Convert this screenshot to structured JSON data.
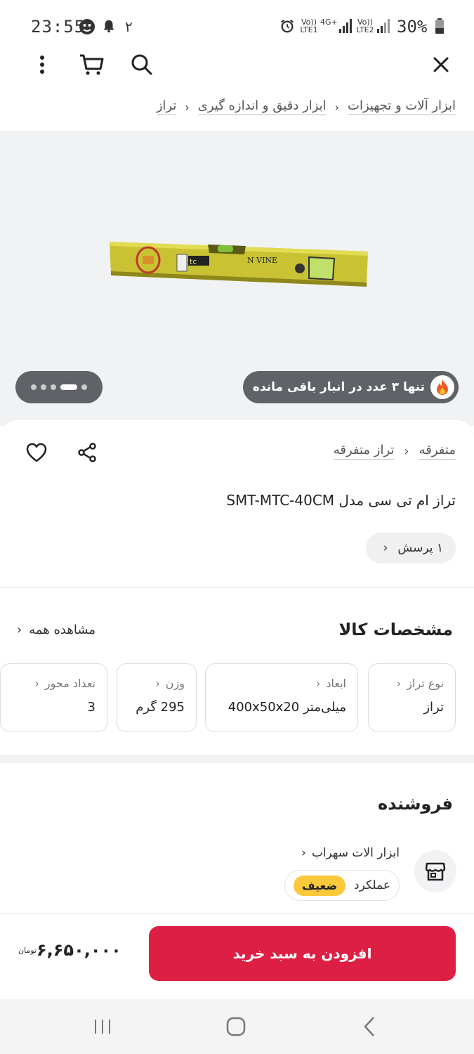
{
  "status_bar": {
    "time": "23:55",
    "notif_count": "۲",
    "net1_top": "Vo))",
    "net1_bottom": "LTE1",
    "net_type": "4G+",
    "net2_top": "Vo))",
    "net2_bottom": "LTE2",
    "battery": "30%"
  },
  "breadcrumb": {
    "items": [
      "ابزار آلات و تجهیزات",
      "ابزار دقیق و  اندازه گیری",
      "تراز"
    ]
  },
  "gallery": {
    "stock_text": "تنها ۳ عدد در انبار باقی مانده",
    "image_label": "N VINE",
    "image_sub": "tc",
    "dots_total": 5,
    "dots_active_index": 3
  },
  "product": {
    "category": "متفرقه",
    "subcategory": "تراز متفرقه",
    "title": "تراز ام تی سی مدل SMT-MTC-40CM",
    "questions": "۱ پرسش"
  },
  "specs": {
    "heading": "مشخصات کالا",
    "see_all": "مشاهده همه",
    "items": [
      {
        "label": "نوع تراز",
        "value": "تراز"
      },
      {
        "label": "ابعاد",
        "value": "میلی‌متر 400x50x20"
      },
      {
        "label": "وزن",
        "value": "295 گرم"
      },
      {
        "label": "تعداد محور",
        "value": "3"
      }
    ]
  },
  "seller": {
    "heading": "فروشنده",
    "name": "ابزار الات سهراب",
    "performance_label": "عملکرد",
    "performance_value": "ضعیف"
  },
  "buy": {
    "button_label": "افزودن به سبد خرید",
    "price": "۶,۶۵۰,۰۰۰",
    "currency": "تومان"
  },
  "colors": {
    "accent": "#de1f44",
    "badge": "#fcc83c",
    "pill": "#5f6266"
  }
}
